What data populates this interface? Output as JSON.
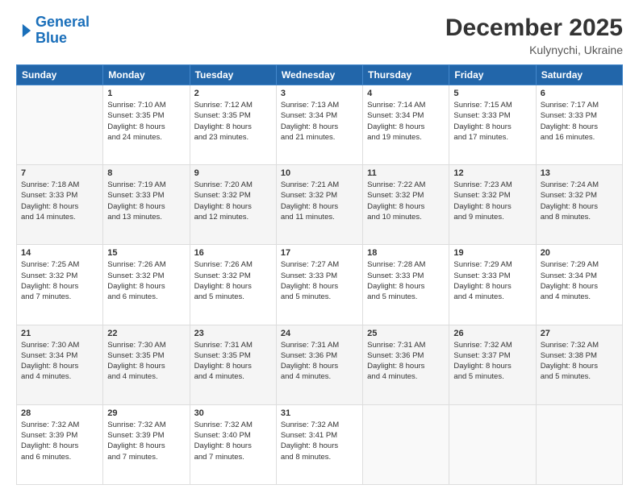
{
  "header": {
    "logo_line1": "General",
    "logo_line2": "Blue",
    "month_year": "December 2025",
    "location": "Kulynychi, Ukraine"
  },
  "weekdays": [
    "Sunday",
    "Monday",
    "Tuesday",
    "Wednesday",
    "Thursday",
    "Friday",
    "Saturday"
  ],
  "weeks": [
    [
      {
        "num": "",
        "info": ""
      },
      {
        "num": "1",
        "info": "Sunrise: 7:10 AM\nSunset: 3:35 PM\nDaylight: 8 hours\nand 24 minutes."
      },
      {
        "num": "2",
        "info": "Sunrise: 7:12 AM\nSunset: 3:35 PM\nDaylight: 8 hours\nand 23 minutes."
      },
      {
        "num": "3",
        "info": "Sunrise: 7:13 AM\nSunset: 3:34 PM\nDaylight: 8 hours\nand 21 minutes."
      },
      {
        "num": "4",
        "info": "Sunrise: 7:14 AM\nSunset: 3:34 PM\nDaylight: 8 hours\nand 19 minutes."
      },
      {
        "num": "5",
        "info": "Sunrise: 7:15 AM\nSunset: 3:33 PM\nDaylight: 8 hours\nand 17 minutes."
      },
      {
        "num": "6",
        "info": "Sunrise: 7:17 AM\nSunset: 3:33 PM\nDaylight: 8 hours\nand 16 minutes."
      }
    ],
    [
      {
        "num": "7",
        "info": "Sunrise: 7:18 AM\nSunset: 3:33 PM\nDaylight: 8 hours\nand 14 minutes."
      },
      {
        "num": "8",
        "info": "Sunrise: 7:19 AM\nSunset: 3:33 PM\nDaylight: 8 hours\nand 13 minutes."
      },
      {
        "num": "9",
        "info": "Sunrise: 7:20 AM\nSunset: 3:32 PM\nDaylight: 8 hours\nand 12 minutes."
      },
      {
        "num": "10",
        "info": "Sunrise: 7:21 AM\nSunset: 3:32 PM\nDaylight: 8 hours\nand 11 minutes."
      },
      {
        "num": "11",
        "info": "Sunrise: 7:22 AM\nSunset: 3:32 PM\nDaylight: 8 hours\nand 10 minutes."
      },
      {
        "num": "12",
        "info": "Sunrise: 7:23 AM\nSunset: 3:32 PM\nDaylight: 8 hours\nand 9 minutes."
      },
      {
        "num": "13",
        "info": "Sunrise: 7:24 AM\nSunset: 3:32 PM\nDaylight: 8 hours\nand 8 minutes."
      }
    ],
    [
      {
        "num": "14",
        "info": "Sunrise: 7:25 AM\nSunset: 3:32 PM\nDaylight: 8 hours\nand 7 minutes."
      },
      {
        "num": "15",
        "info": "Sunrise: 7:26 AM\nSunset: 3:32 PM\nDaylight: 8 hours\nand 6 minutes."
      },
      {
        "num": "16",
        "info": "Sunrise: 7:26 AM\nSunset: 3:32 PM\nDaylight: 8 hours\nand 5 minutes."
      },
      {
        "num": "17",
        "info": "Sunrise: 7:27 AM\nSunset: 3:33 PM\nDaylight: 8 hours\nand 5 minutes."
      },
      {
        "num": "18",
        "info": "Sunrise: 7:28 AM\nSunset: 3:33 PM\nDaylight: 8 hours\nand 5 minutes."
      },
      {
        "num": "19",
        "info": "Sunrise: 7:29 AM\nSunset: 3:33 PM\nDaylight: 8 hours\nand 4 minutes."
      },
      {
        "num": "20",
        "info": "Sunrise: 7:29 AM\nSunset: 3:34 PM\nDaylight: 8 hours\nand 4 minutes."
      }
    ],
    [
      {
        "num": "21",
        "info": "Sunrise: 7:30 AM\nSunset: 3:34 PM\nDaylight: 8 hours\nand 4 minutes."
      },
      {
        "num": "22",
        "info": "Sunrise: 7:30 AM\nSunset: 3:35 PM\nDaylight: 8 hours\nand 4 minutes."
      },
      {
        "num": "23",
        "info": "Sunrise: 7:31 AM\nSunset: 3:35 PM\nDaylight: 8 hours\nand 4 minutes."
      },
      {
        "num": "24",
        "info": "Sunrise: 7:31 AM\nSunset: 3:36 PM\nDaylight: 8 hours\nand 4 minutes."
      },
      {
        "num": "25",
        "info": "Sunrise: 7:31 AM\nSunset: 3:36 PM\nDaylight: 8 hours\nand 4 minutes."
      },
      {
        "num": "26",
        "info": "Sunrise: 7:32 AM\nSunset: 3:37 PM\nDaylight: 8 hours\nand 5 minutes."
      },
      {
        "num": "27",
        "info": "Sunrise: 7:32 AM\nSunset: 3:38 PM\nDaylight: 8 hours\nand 5 minutes."
      }
    ],
    [
      {
        "num": "28",
        "info": "Sunrise: 7:32 AM\nSunset: 3:39 PM\nDaylight: 8 hours\nand 6 minutes."
      },
      {
        "num": "29",
        "info": "Sunrise: 7:32 AM\nSunset: 3:39 PM\nDaylight: 8 hours\nand 7 minutes."
      },
      {
        "num": "30",
        "info": "Sunrise: 7:32 AM\nSunset: 3:40 PM\nDaylight: 8 hours\nand 7 minutes."
      },
      {
        "num": "31",
        "info": "Sunrise: 7:32 AM\nSunset: 3:41 PM\nDaylight: 8 hours\nand 8 minutes."
      },
      {
        "num": "",
        "info": ""
      },
      {
        "num": "",
        "info": ""
      },
      {
        "num": "",
        "info": ""
      }
    ]
  ]
}
